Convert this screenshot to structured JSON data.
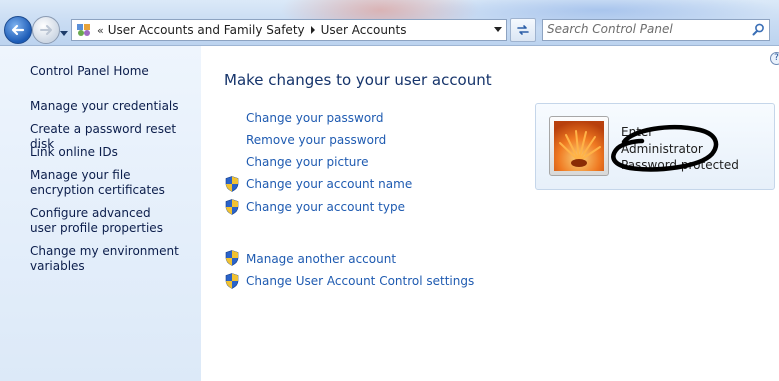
{
  "address_bar": {
    "overflow_marker": "«",
    "breadcrumbs": [
      "User Accounts and Family Safety",
      "User Accounts"
    ]
  },
  "search": {
    "placeholder": "Search Control Panel"
  },
  "left_pane": {
    "items": [
      "Control Panel Home",
      "Manage your credentials",
      "Create a password reset disk",
      "Link online IDs",
      "Manage your file encryption certificates",
      "Configure advanced user profile properties",
      "Change my environment variables"
    ]
  },
  "main": {
    "title": "Make changes to your user account",
    "tasks": [
      "Change your password",
      "Remove your password",
      "Change your picture",
      "Change your account name",
      "Change your account type"
    ],
    "other_tasks": [
      "Manage another account",
      "Change User Account Control settings"
    ]
  },
  "account": {
    "name": "Enter",
    "type": "Administrator",
    "status": "Password protected"
  },
  "help": {
    "label": "?"
  },
  "icons": {
    "back": "back-arrow-icon",
    "forward": "forward-arrow-icon",
    "history": "chevron-down-icon",
    "location": "control-panel-icon",
    "refresh": "refresh-icon",
    "search": "search-icon",
    "uac": "uac-shield-icon"
  }
}
